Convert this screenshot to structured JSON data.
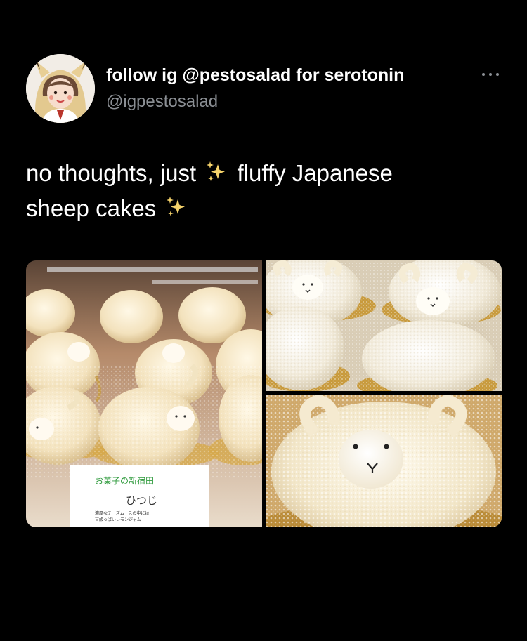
{
  "user": {
    "display_name": "follow ig @pestosalad for serotonin",
    "handle": "@igpestosalad"
  },
  "tweet": {
    "line1_before": "no thoughts, just ",
    "line1_after": " fluffy Japanese",
    "line2": "sheep cakes "
  },
  "icons": {
    "more": "more-horizontal-icon",
    "sparkles": "sparkles-emoji"
  },
  "media": {
    "sign_brand": "お菓子の新宿田",
    "sign_title": "ひつじ",
    "sign_line1": "濃厚なチーズムースの中には",
    "sign_line2": "甘酸っぱいレモンジャム"
  },
  "colors": {
    "background": "#000000",
    "text": "#ffffff",
    "secondary_text": "#8b8f94"
  }
}
